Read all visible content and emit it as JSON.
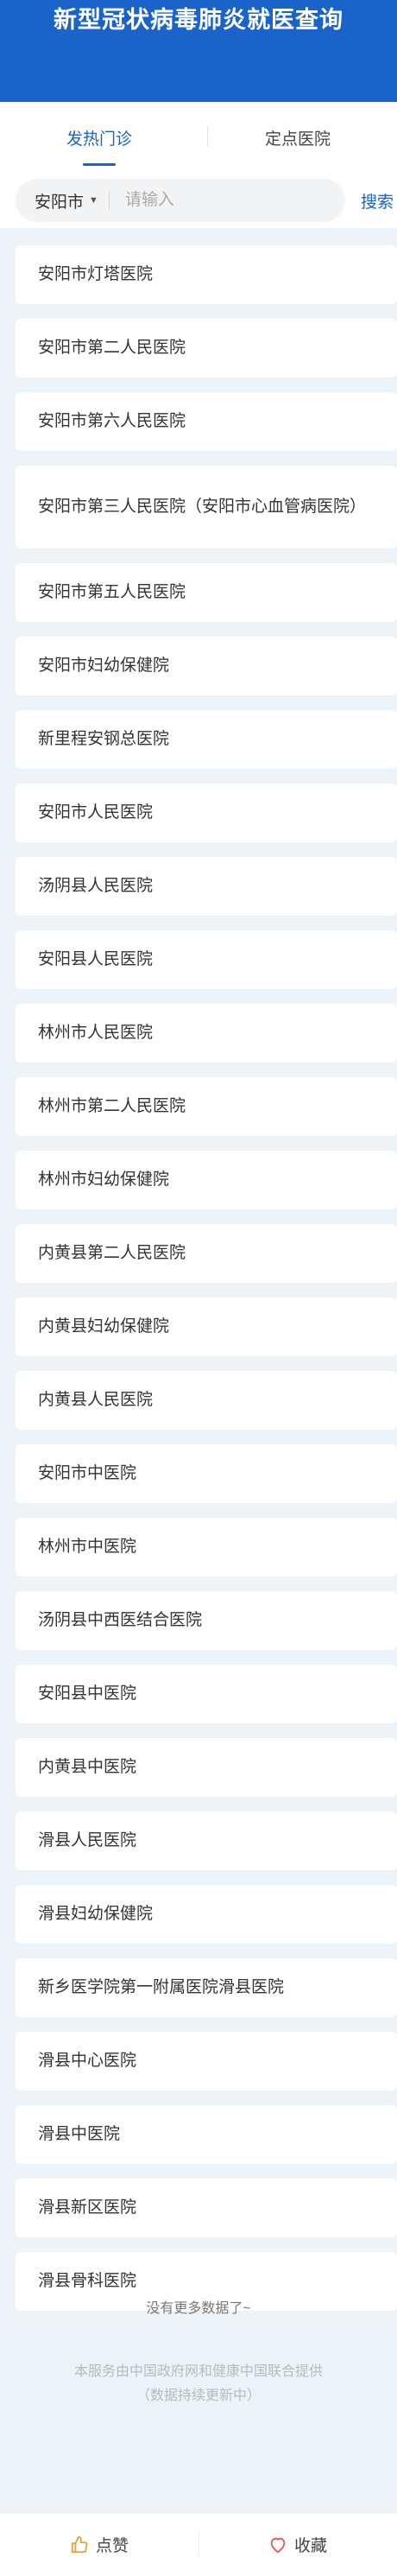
{
  "header": {
    "title": "新型冠状病毒肺炎就医查询"
  },
  "tabs": [
    {
      "label": "发热门诊",
      "active": true
    },
    {
      "label": "定点医院",
      "active": false
    }
  ],
  "search": {
    "city": "安阳市",
    "placeholder": "请输入",
    "value": "",
    "button": "搜索"
  },
  "hospitals": [
    "安阳市灯塔医院",
    "安阳市第二人民医院",
    "安阳市第六人民医院",
    "安阳市第三人民医院（安阳市心血管病医院）",
    "安阳市第五人民医院",
    "安阳市妇幼保健院",
    "新里程安钢总医院",
    "安阳市人民医院",
    "汤阴县人民医院",
    "安阳县人民医院",
    "林州市人民医院",
    "林州市第二人民医院",
    "林州市妇幼保健院",
    "内黄县第二人民医院",
    "内黄县妇幼保健院",
    "内黄县人民医院",
    "安阳市中医院",
    "林州市中医院",
    "汤阴县中西医结合医院",
    "安阳县中医院",
    "内黄县中医院",
    "滑县人民医院",
    "滑县妇幼保健院",
    "新乡医学院第一附属医院滑县医院",
    "滑县中心医院",
    "滑县中医院",
    "滑县新区医院",
    "滑县骨科医院"
  ],
  "status": {
    "no_more": "没有更多数据了~"
  },
  "footer": {
    "line1": "本服务由中国政府网和健康中国联合提供",
    "line2": "（数据持续更新中）"
  },
  "bottom_bar": {
    "like_label": "点赞",
    "favorite_label": "收藏"
  },
  "colors": {
    "brand": "#1a63c9",
    "background": "#eef3f8",
    "like_icon": "#e0a53a",
    "favorite_icon": "#e05a5a"
  }
}
